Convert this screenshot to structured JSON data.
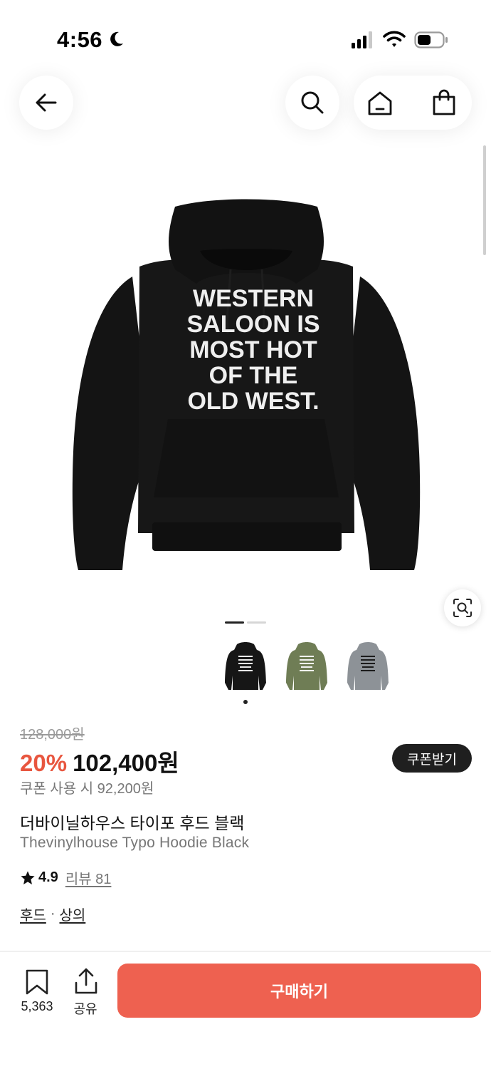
{
  "status_bar": {
    "time": "4:56"
  },
  "header": {
    "back_icon": "arrow-left-icon",
    "search_icon": "search-icon",
    "home_icon": "home-icon",
    "cart_icon": "shopping-bag-icon"
  },
  "product_image": {
    "hoodie_text_lines": [
      "WESTERN",
      "SALOON IS",
      "MOST HOT",
      "OF THE",
      "OLD WEST."
    ],
    "colors": {
      "black": "#161616",
      "khaki": "#6f7d55",
      "gray": "#8d9297"
    }
  },
  "gallery": {
    "visual_search_icon": "visual-search-icon",
    "page_count": 2,
    "active_page": 1
  },
  "price": {
    "original": "128,000원",
    "discount_rate": "20%",
    "sale": "102,400원",
    "coupon_button": "쿠폰받기",
    "coupon_price": "쿠폰 사용 시 92,200원",
    "accent_color": "#e8563f"
  },
  "product": {
    "name": "더바이닐하우스 타이포 후드 블랙",
    "name_en": "Thevinylhouse Typo Hoodie Black",
    "rating": "4.9",
    "review_link": "리뷰 81",
    "categories": [
      "후드",
      "상의"
    ],
    "category_separator": "·"
  },
  "bottom_bar": {
    "bookmark_count": "5,363",
    "share_label": "공유",
    "buy_label": "구매하기",
    "buy_color": "#ee6150"
  }
}
